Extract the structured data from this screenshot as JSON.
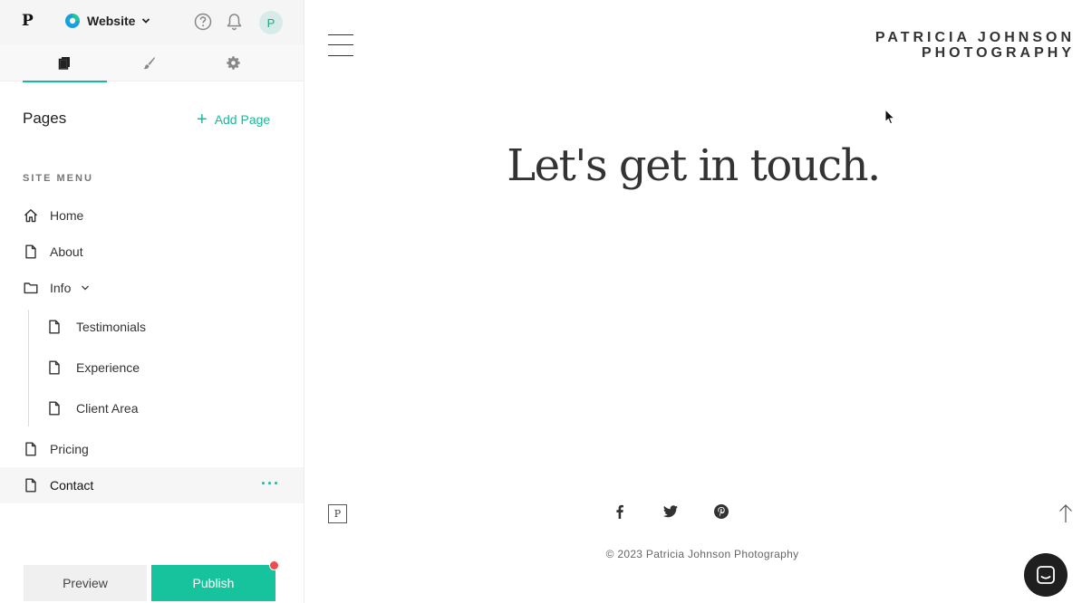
{
  "app": {
    "logo_letter": "P",
    "site_switcher_label": "Website",
    "avatar_letter": "P"
  },
  "sidebar": {
    "tabs": [
      {
        "name": "pages",
        "icon": "pages-icon",
        "active": true
      },
      {
        "name": "design",
        "icon": "brush-icon",
        "active": false
      },
      {
        "name": "settings",
        "icon": "gear-icon",
        "active": false
      }
    ],
    "pages_title": "Pages",
    "add_page_label": "Add Page",
    "site_menu_label": "SITE MENU",
    "items": [
      {
        "label": "Home",
        "icon": "home-icon"
      },
      {
        "label": "About",
        "icon": "page-icon"
      },
      {
        "label": "Info",
        "icon": "folder-icon"
      },
      {
        "label": "Testimonials",
        "icon": "page-icon"
      },
      {
        "label": "Experience",
        "icon": "page-icon"
      },
      {
        "label": "Client Area",
        "icon": "page-icon"
      },
      {
        "label": "Pricing",
        "icon": "page-icon"
      },
      {
        "label": "Contact",
        "icon": "page-icon",
        "selected": true
      }
    ],
    "more_label": "···",
    "preview_label": "Preview",
    "publish_label": "Publish"
  },
  "site": {
    "brand_line_1": "PATRICIA JOHNSON",
    "brand_line_2": "PHOTOGRAPHY",
    "headline": "Let's get in touch.",
    "footer_logo_letter": "P",
    "social": [
      "facebook-icon",
      "twitter-icon",
      "pinterest-icon"
    ],
    "copyright": "© 2023 Patricia Johnson Photography"
  },
  "colors": {
    "accent": "#17b998",
    "publish": "#17c39d",
    "notification": "#ef4b4b",
    "chat": "#1f1f1f"
  }
}
